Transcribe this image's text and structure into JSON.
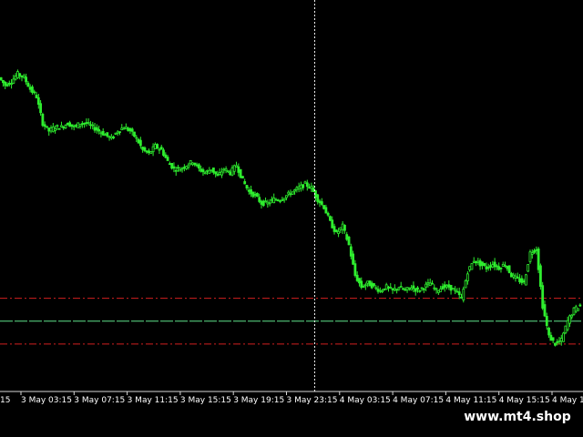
{
  "chart_data": {
    "type": "candlestick",
    "time_labels": [
      "3 May 03:15",
      "3 May 07:15",
      "3 May 11:15",
      "3 May 15:15",
      "3 May 19:15",
      "3 May 23:15",
      "4 May 03:15",
      "4 May 07:15",
      "4 May 11:15",
      "4 May 15:15",
      "4 May 1"
    ],
    "leading_label": "15",
    "ylim": [
      0,
      1
    ],
    "price_path": [
      0.82,
      0.8,
      0.81,
      0.83,
      0.82,
      0.79,
      0.77,
      0.7,
      0.68,
      0.69,
      0.69,
      0.7,
      0.69,
      0.7,
      0.7,
      0.69,
      0.68,
      0.67,
      0.66,
      0.68,
      0.69,
      0.68,
      0.66,
      0.63,
      0.62,
      0.64,
      0.63,
      0.6,
      0.58,
      0.58,
      0.59,
      0.6,
      0.58,
      0.57,
      0.58,
      0.56,
      0.58,
      0.57,
      0.59,
      0.55,
      0.52,
      0.51,
      0.49,
      0.49,
      0.5,
      0.5,
      0.51,
      0.52,
      0.53,
      0.54,
      0.53,
      0.5,
      0.48,
      0.44,
      0.41,
      0.43,
      0.38,
      0.3,
      0.27,
      0.28,
      0.27,
      0.26,
      0.27,
      0.26,
      0.27,
      0.26,
      0.27,
      0.26,
      0.27,
      0.28,
      0.26,
      0.27,
      0.27,
      0.26,
      0.24,
      0.31,
      0.34,
      0.33,
      0.32,
      0.33,
      0.32,
      0.33,
      0.3,
      0.29,
      0.28,
      0.36,
      0.37,
      0.22,
      0.14,
      0.12,
      0.13,
      0.18,
      0.21,
      0.22
    ],
    "horizontal_levels": [
      {
        "value": 0.24,
        "style": "dash-dot",
        "color": "#d2201f"
      },
      {
        "value": 0.18,
        "style": "solid-dash",
        "color": "#5fe28a"
      },
      {
        "value": 0.12,
        "style": "dash-dot",
        "color": "#d2201f"
      }
    ],
    "crosshair_time_index": 5.05,
    "colors": {
      "background": "#000000",
      "candle": "#2fee2f",
      "axis": "#d8d8d8",
      "crosshair": "#ffffff"
    }
  },
  "watermark": {
    "text": "www.mt4.shop"
  }
}
